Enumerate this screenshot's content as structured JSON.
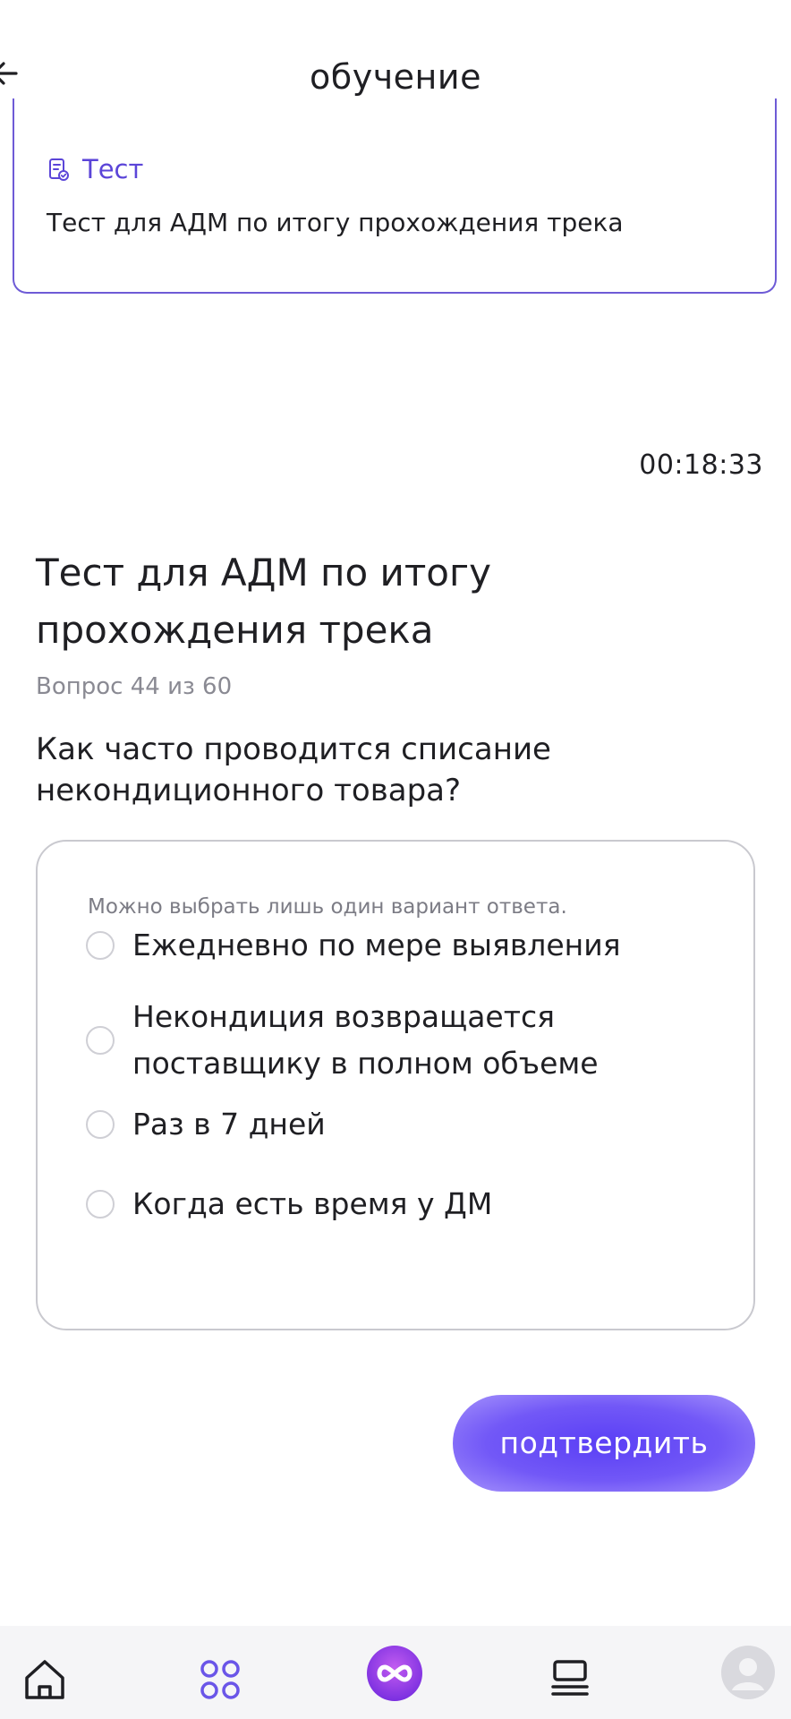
{
  "header": {
    "title": "обучение",
    "back_icon": "arrow-left-icon"
  },
  "test_card": {
    "tag_icon": "document-check-icon",
    "tag_label": "Тест",
    "title": "Тест для АДМ по итогу прохождения трека"
  },
  "timer": "00:18:33",
  "test": {
    "heading": "Тест для АДМ по итогу прохождения трека",
    "counter": "Вопрос 44 из 60",
    "question": "Как часто проводится списание некондиционного товара?"
  },
  "answers": {
    "hint": "Можно выбрать лишь один вариант ответа.",
    "options": [
      {
        "label": "Ежедневно по мере выявления"
      },
      {
        "label": "Некондиция возвращается поставщику в полном объеме"
      },
      {
        "label": "Раз в 7 дней"
      },
      {
        "label": "Когда есть время у ДМ"
      }
    ]
  },
  "confirm_label": "подтвердить",
  "bottom_nav": {
    "items": [
      {
        "icon": "home-icon"
      },
      {
        "icon": "catalog-grid-icon"
      },
      {
        "icon": "infinity-logo-icon"
      },
      {
        "icon": "courses-list-icon"
      },
      {
        "icon": "profile-avatar-icon"
      }
    ]
  },
  "colors": {
    "accent": "#5b45d8",
    "card_border": "#6e5bd6",
    "button_gradient_center": "#5a3ff5",
    "button_gradient_edge": "#a592fb",
    "nav_background": "#f5f5f7"
  }
}
